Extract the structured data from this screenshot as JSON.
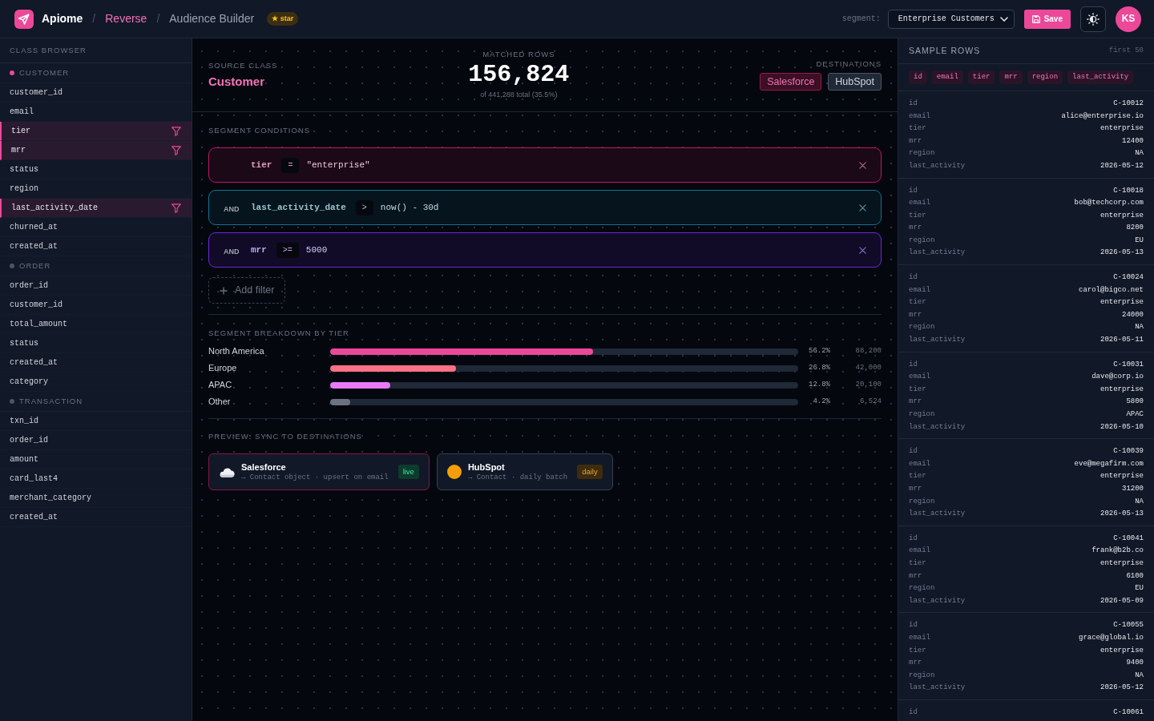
{
  "topbar": {
    "brand": "Apiome",
    "breadcrumbs": [
      {
        "separator": "/",
        "label": "Reverse",
        "kind": "link"
      },
      {
        "separator": "/",
        "label": "Audience Builder",
        "kind": "current"
      }
    ],
    "badge": "★ star",
    "segment_label": "segment:",
    "segment_select": {
      "value": "Enterprise Customers"
    },
    "save_button": "Save",
    "avatar": "KS"
  },
  "sidebar": {
    "title": "CLASS BROWSER",
    "groups": [
      {
        "name": "CUSTOMER",
        "selected": true,
        "fields": [
          {
            "name": "customer_id",
            "filtered": false
          },
          {
            "name": "email",
            "filtered": false
          },
          {
            "name": "tier",
            "filtered": true
          },
          {
            "name": "mrr",
            "filtered": true
          },
          {
            "name": "status",
            "filtered": false
          },
          {
            "name": "region",
            "filtered": false
          },
          {
            "name": "last_activity_date",
            "filtered": true
          },
          {
            "name": "churned_at",
            "filtered": false
          },
          {
            "name": "created_at",
            "filtered": false
          }
        ]
      },
      {
        "name": "ORDER",
        "selected": false,
        "fields": [
          {
            "name": "order_id",
            "filtered": false
          },
          {
            "name": "customer_id",
            "filtered": false
          },
          {
            "name": "total_amount",
            "filtered": false
          },
          {
            "name": "status",
            "filtered": false
          },
          {
            "name": "created_at",
            "filtered": false
          },
          {
            "name": "category",
            "filtered": false
          }
        ]
      },
      {
        "name": "TRANSACTION",
        "selected": false,
        "fields": [
          {
            "name": "txn_id",
            "filtered": false
          },
          {
            "name": "order_id",
            "filtered": false
          },
          {
            "name": "amount",
            "filtered": false
          },
          {
            "name": "card_last4",
            "filtered": false
          },
          {
            "name": "merchant_category",
            "filtered": false
          },
          {
            "name": "created_at",
            "filtered": false
          }
        ]
      }
    ]
  },
  "summary": {
    "source_label": "SOURCE CLASS",
    "source": "Customer",
    "matched_label": "MATCHED ROWS",
    "matched": "156,824",
    "matched_note": "of 441,288 total (35.5%)",
    "destinations_label": "DESTINATIONS",
    "destinations": [
      {
        "name": "Salesforce",
        "selected": true
      },
      {
        "name": "HubSpot",
        "selected": false
      }
    ]
  },
  "conditions": {
    "title": "SEGMENT CONDITIONS",
    "items": [
      {
        "field": "tier",
        "operator": "=",
        "value": "\"enterprise\"",
        "color": "#be185d"
      },
      {
        "connector": "AND",
        "field": "last_activity_date",
        "operator": ">",
        "value": "now() - 30d",
        "color": "#0e7490"
      },
      {
        "connector": "AND",
        "field": "mrr",
        "operator": ">=",
        "value": "5000",
        "color": "#6d28d9"
      }
    ],
    "add_button": "Add filter"
  },
  "breakdown": {
    "title": "SEGMENT BREAKDOWN BY TIER",
    "rows": [
      {
        "label": "North America",
        "level": 0.562,
        "percent": "56.2%",
        "count": "88,200",
        "color": "#ec4899"
      },
      {
        "label": "Europe",
        "level": 0.268,
        "percent": "26.8%",
        "count": "42,000",
        "color": "#fb7185"
      },
      {
        "label": "APAC",
        "level": 0.128,
        "percent": "12.8%",
        "count": "20,100",
        "color": "#e879f9"
      },
      {
        "label": "Other",
        "level": 0.042,
        "percent": "4.2%",
        "count": "6,524",
        "color": "#6b7280"
      }
    ]
  },
  "sync_preview": {
    "title": "PREVIEW: SYNC TO DESTINATIONS",
    "cards": [
      {
        "name": "Salesforce",
        "detail": "→ Contact object · upsert on email",
        "selected": true,
        "badge": {
          "label": "live",
          "color": "#0d3b2c"
        }
      },
      {
        "name": "HubSpot",
        "detail": "→ Contact · daily batch",
        "selected": false,
        "badge": {
          "label": "daily",
          "color": "#3d2c0e"
        }
      }
    ]
  },
  "sample_rows": {
    "title": "SAMPLE ROWS",
    "note": "first 50",
    "columns": [
      "id",
      "email",
      "tier",
      "mrr",
      "region",
      "last_activity"
    ],
    "records": [
      {
        "fields": [
          {
            "label": "id",
            "value": "C-10012"
          },
          {
            "label": "email",
            "value": "alice@enterprise.io"
          },
          {
            "label": "tier",
            "value": "enterprise"
          },
          {
            "label": "mrr",
            "value": "12400"
          },
          {
            "label": "region",
            "value": "NA"
          },
          {
            "label": "last_activity",
            "value": "2026-05-12"
          }
        ]
      },
      {
        "fields": [
          {
            "label": "id",
            "value": "C-10018"
          },
          {
            "label": "email",
            "value": "bob@techcorp.com"
          },
          {
            "label": "tier",
            "value": "enterprise"
          },
          {
            "label": "mrr",
            "value": "8200"
          },
          {
            "label": "region",
            "value": "EU"
          },
          {
            "label": "last_activity",
            "value": "2026-05-13"
          }
        ]
      },
      {
        "fields": [
          {
            "label": "id",
            "value": "C-10024"
          },
          {
            "label": "email",
            "value": "carol@bigco.net"
          },
          {
            "label": "tier",
            "value": "enterprise"
          },
          {
            "label": "mrr",
            "value": "24000"
          },
          {
            "label": "region",
            "value": "NA"
          },
          {
            "label": "last_activity",
            "value": "2026-05-11"
          }
        ]
      },
      {
        "fields": [
          {
            "label": "id",
            "value": "C-10031"
          },
          {
            "label": "email",
            "value": "dave@corp.io"
          },
          {
            "label": "tier",
            "value": "enterprise"
          },
          {
            "label": "mrr",
            "value": "5800"
          },
          {
            "label": "region",
            "value": "APAC"
          },
          {
            "label": "last_activity",
            "value": "2026-05-10"
          }
        ]
      },
      {
        "fields": [
          {
            "label": "id",
            "value": "C-10039"
          },
          {
            "label": "email",
            "value": "eve@megafirm.com"
          },
          {
            "label": "tier",
            "value": "enterprise"
          },
          {
            "label": "mrr",
            "value": "31200"
          },
          {
            "label": "region",
            "value": "NA"
          },
          {
            "label": "last_activity",
            "value": "2026-05-13"
          }
        ]
      },
      {
        "fields": [
          {
            "label": "id",
            "value": "C-10041"
          },
          {
            "label": "email",
            "value": "frank@b2b.co"
          },
          {
            "label": "tier",
            "value": "enterprise"
          },
          {
            "label": "mrr",
            "value": "6100"
          },
          {
            "label": "region",
            "value": "EU"
          },
          {
            "label": "last_activity",
            "value": "2026-05-09"
          }
        ]
      },
      {
        "fields": [
          {
            "label": "id",
            "value": "C-10055"
          },
          {
            "label": "email",
            "value": "grace@global.io"
          },
          {
            "label": "tier",
            "value": "enterprise"
          },
          {
            "label": "mrr",
            "value": "9400"
          },
          {
            "label": "region",
            "value": "NA"
          },
          {
            "label": "last_activity",
            "value": "2026-05-12"
          }
        ]
      },
      {
        "fields": [
          {
            "label": "id",
            "value": "C-10061"
          }
        ]
      }
    ]
  }
}
